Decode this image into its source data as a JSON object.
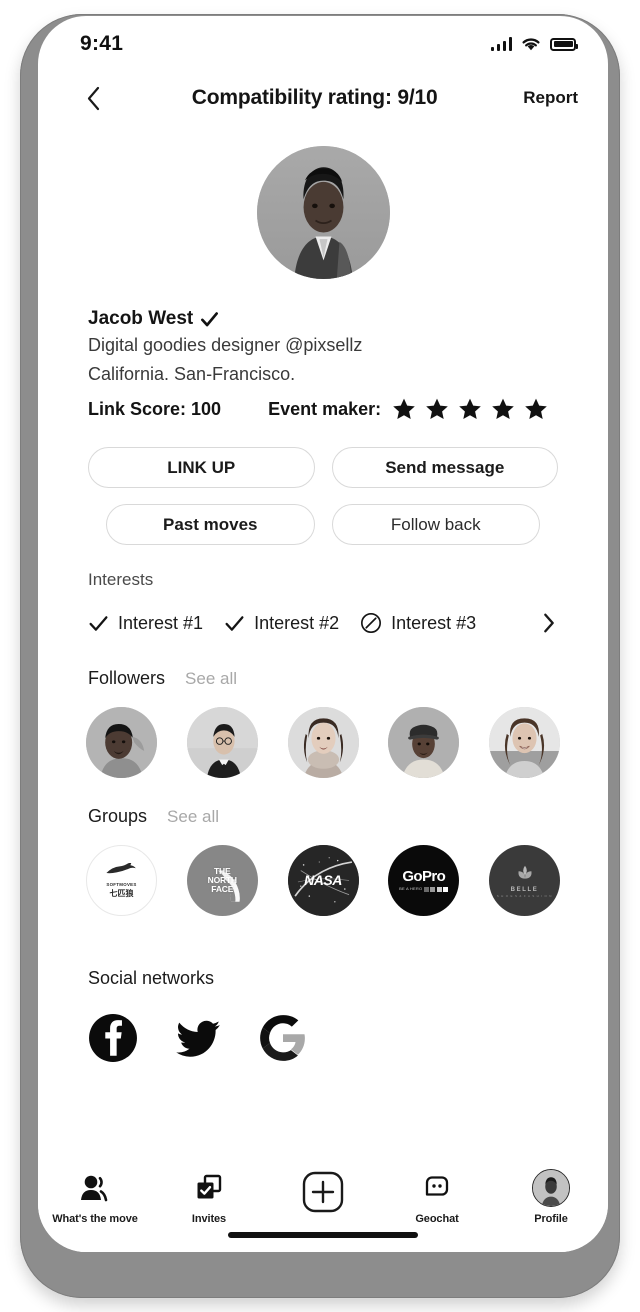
{
  "status_bar": {
    "time": "9:41",
    "signal_icon": "signal-bars-icon",
    "wifi_icon": "wifi-icon",
    "battery_icon": "battery-full-icon"
  },
  "header": {
    "back_icon": "chevron-left-icon",
    "title": "Compatibility rating: 9/10",
    "report_label": "Report"
  },
  "profile": {
    "avatar_icon": "profile-photo",
    "name": "Jacob West",
    "verified_icon": "verified-check-icon",
    "bio_line1": "Digital goodies designer @pixsellz",
    "bio_line2": "California. San-Francisco.",
    "link_score_label": "Link Score: 100",
    "event_maker_label": "Event maker:",
    "event_maker_stars": 5,
    "star_icon": "star-filled-icon"
  },
  "actions": {
    "link_up": "LINK UP",
    "send_message": "Send message",
    "past_moves": "Past moves",
    "follow_back": "Follow back"
  },
  "interests": {
    "title": "Interests",
    "items": [
      {
        "label": "Interest #1",
        "icon": "check-icon"
      },
      {
        "label": "Interest #2",
        "icon": "check-icon"
      },
      {
        "label": "Interest #3",
        "icon": "circle-slash-icon"
      }
    ],
    "more_icon": "chevron-right-icon"
  },
  "followers": {
    "title": "Followers",
    "see_all": "See all",
    "avatars": [
      "follower-avatar-1",
      "follower-avatar-2",
      "follower-avatar-3",
      "follower-avatar-4",
      "follower-avatar-5"
    ]
  },
  "groups": {
    "title": "Groups",
    "see_all": "See all",
    "items": [
      {
        "name": "SOFTMOVES",
        "sub": "七匹狼",
        "logo": "softmoves-logo",
        "bg": "#ffffff",
        "fg": "#2a2a2a",
        "border": "#e4e4e4"
      },
      {
        "name": "THE NORTH FACE",
        "sub": "",
        "logo": "north-face-logo",
        "bg": "#878787",
        "fg": "#ffffff",
        "border": "#878787"
      },
      {
        "name": "NASA",
        "sub": "",
        "logo": "nasa-logo",
        "bg": "#2e2e2e",
        "fg": "#ffffff",
        "border": "#2e2e2e"
      },
      {
        "name": "GoPro",
        "sub": "BE A HERO",
        "logo": "gopro-logo",
        "bg": "#0a0a0a",
        "fg": "#ffffff",
        "border": "#0a0a0a"
      },
      {
        "name": "BELLE",
        "sub": "",
        "logo": "belle-logo",
        "bg": "#3a3a3a",
        "fg": "#b9b9b9",
        "border": "#3a3a3a"
      }
    ]
  },
  "social": {
    "title": "Social networks",
    "items": [
      {
        "name": "facebook",
        "icon": "facebook-icon"
      },
      {
        "name": "twitter",
        "icon": "twitter-icon"
      },
      {
        "name": "google",
        "icon": "google-icon"
      }
    ]
  },
  "tabbar": {
    "items": [
      {
        "label": "What's the move",
        "icon": "people-icon"
      },
      {
        "label": "Invites",
        "icon": "invites-check-squares-icon"
      },
      {
        "label": "",
        "icon": "plus-square-icon"
      },
      {
        "label": "Geochat",
        "icon": "chat-bubble-icon"
      },
      {
        "label": "Profile",
        "icon": "profile-avatar-icon"
      }
    ]
  },
  "colors": {
    "frame": "#8d8d8d",
    "screen": "#ffffff",
    "text": "#141414",
    "muted": "#a8a8a8",
    "border": "#d9d9d9"
  }
}
